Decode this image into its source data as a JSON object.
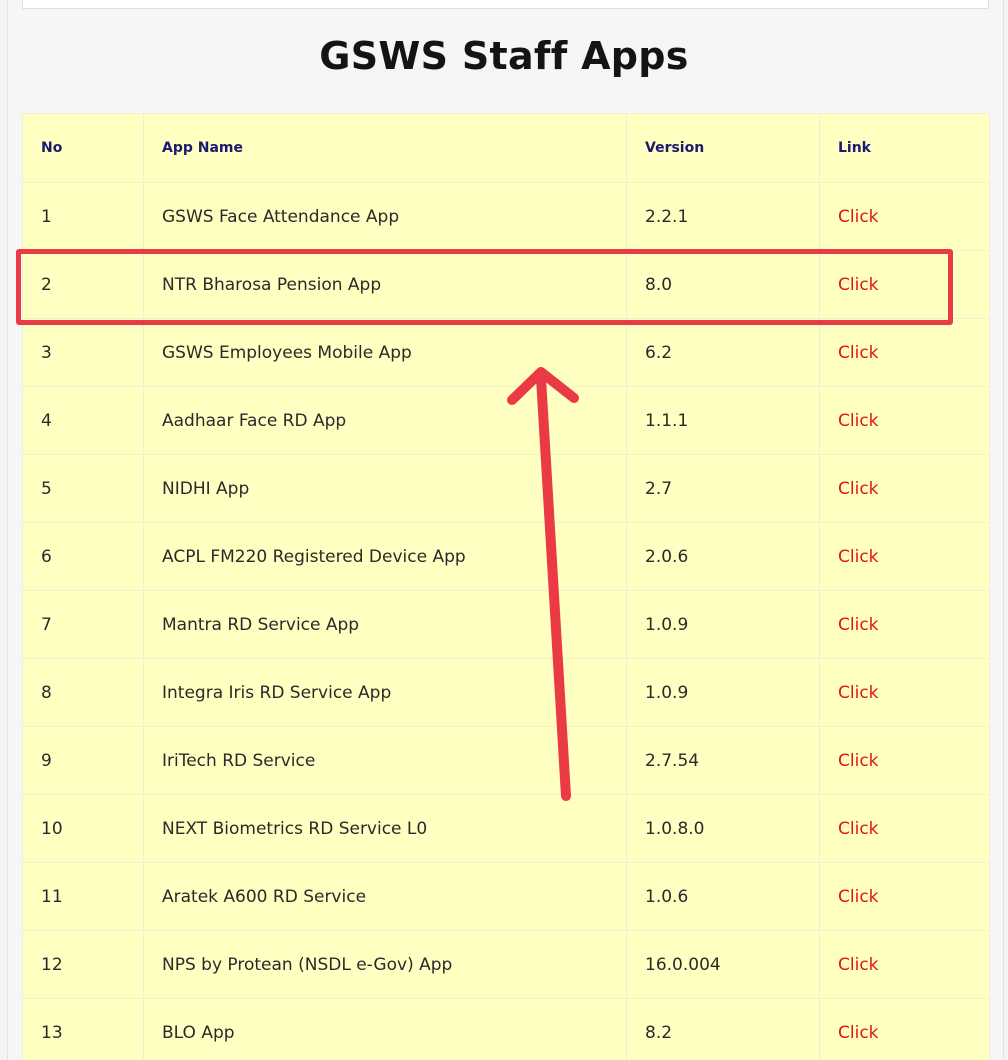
{
  "page": {
    "title": "GSWS Staff Apps"
  },
  "table": {
    "headers": {
      "no": "No",
      "app_name": "App Name",
      "version": "Version",
      "link": "Link"
    },
    "rows": [
      {
        "no": "1",
        "name": "GSWS Face Attendance App",
        "version": "2.2.1",
        "link": "Click"
      },
      {
        "no": "2",
        "name": "NTR Bharosa Pension App",
        "version": "8.0",
        "link": "Click"
      },
      {
        "no": "3",
        "name": "GSWS Employees Mobile App",
        "version": "6.2",
        "link": "Click"
      },
      {
        "no": "4",
        "name": "Aadhaar Face RD App",
        "version": "1.1.1",
        "link": "Click"
      },
      {
        "no": "5",
        "name": "NIDHI App",
        "version": "2.7",
        "link": "Click"
      },
      {
        "no": "6",
        "name": "ACPL FM220 Registered Device App",
        "version": "2.0.6",
        "link": "Click"
      },
      {
        "no": "7",
        "name": "Mantra RD Service App",
        "version": "1.0.9",
        "link": "Click"
      },
      {
        "no": "8",
        "name": "Integra Iris RD Service App",
        "version": "1.0.9",
        "link": "Click"
      },
      {
        "no": "9",
        "name": "IriTech RD Service",
        "version": "2.7.54",
        "link": "Click"
      },
      {
        "no": "10",
        "name": "NEXT Biometrics RD Service L0",
        "version": "1.0.8.0",
        "link": "Click"
      },
      {
        "no": "11",
        "name": "Aratek A600 RD Service",
        "version": "1.0.6",
        "link": "Click"
      },
      {
        "no": "12",
        "name": "NPS by Protean (NSDL e-Gov) App",
        "version": "16.0.004",
        "link": "Click"
      },
      {
        "no": "13",
        "name": "BLO App",
        "version": "8.2",
        "link": "Click"
      }
    ]
  },
  "colors": {
    "table_bg": "#ffffc2",
    "header_text": "#1a1a70",
    "link": "#e2141b",
    "annotation": "#ea3a46"
  },
  "annotation": {
    "highlighted_row": "2",
    "arrow_icon": "arrow-up-icon"
  }
}
